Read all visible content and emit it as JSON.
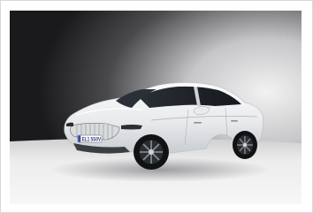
{
  "image": {
    "subject": "car-photo",
    "license_plate": "EL1 5S0V",
    "colors": {
      "backdrop_dark": "#1c1c1e",
      "backdrop_light": "#e9e9eb",
      "floor": "#f4f4f5",
      "car_body": "#eef0f2",
      "glass": "#1d2126",
      "tire": "#111214"
    }
  }
}
